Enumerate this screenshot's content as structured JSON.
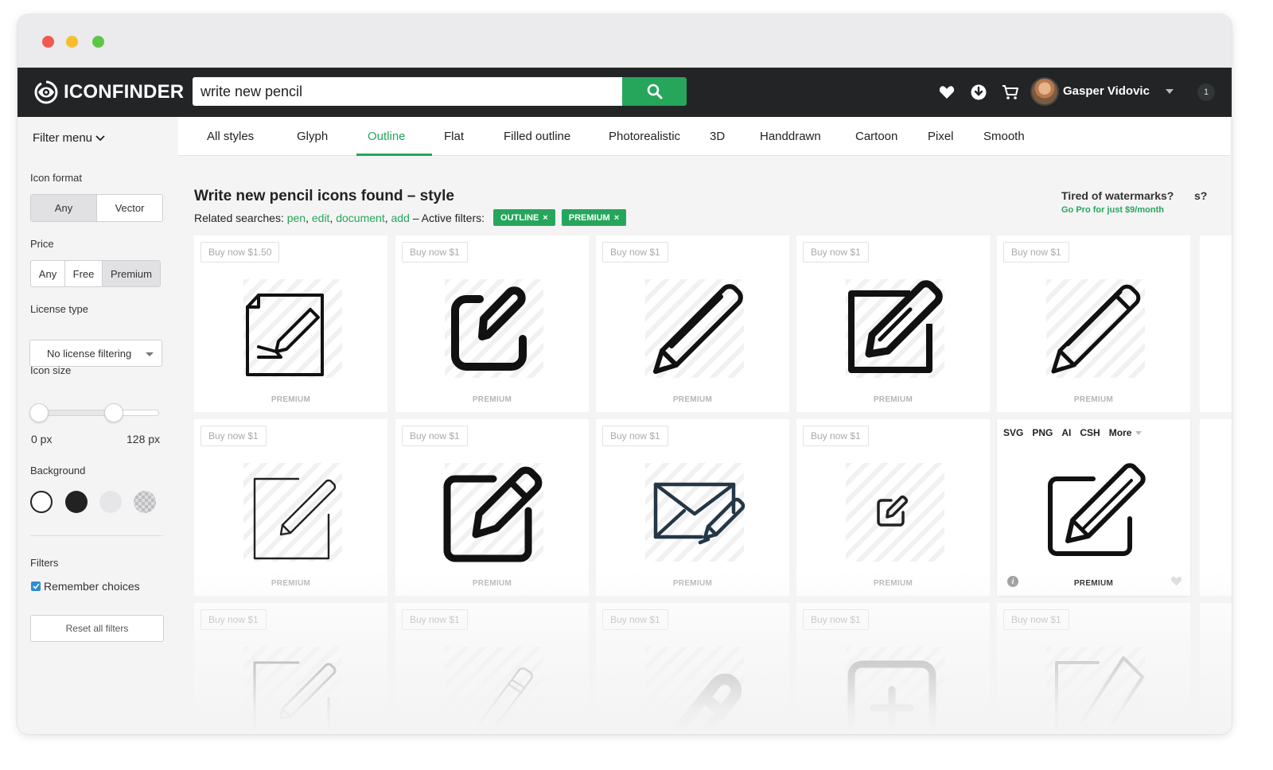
{
  "header": {
    "logo_text": "ICONFINDER",
    "search_value": "write new pencil",
    "user_name": "Gasper Vidovic",
    "notification_count": "1"
  },
  "sidebar": {
    "filter_menu_label": "Filter menu",
    "icon_format": {
      "label": "Icon format",
      "options": [
        "Any",
        "Vector"
      ],
      "selected": "Any"
    },
    "price": {
      "label": "Price",
      "options": [
        "Any",
        "Free",
        "Premium"
      ],
      "selected": "Premium"
    },
    "license_type": {
      "label": "License type",
      "selected": "No license filtering"
    },
    "icon_size": {
      "label": "Icon size",
      "min_label": "0 px",
      "max_label": "128 px"
    },
    "background": {
      "label": "Background",
      "swatches": [
        "white",
        "black",
        "light-grey",
        "transparent"
      ]
    },
    "filters_label": "Filters",
    "remember_choices": "Remember choices",
    "reset_label": "Reset all filters"
  },
  "style_tabs": {
    "items": [
      "All styles",
      "Glyph",
      "Outline",
      "Flat",
      "Filled outline",
      "Photorealistic",
      "3D",
      "Handdrawn",
      "Cartoon",
      "Pixel",
      "Smooth"
    ],
    "active": "Outline"
  },
  "results": {
    "title": "Write new pencil icons found – style",
    "related_prefix": "Related searches:",
    "related_links": [
      "pen",
      "edit",
      "document",
      "add"
    ],
    "active_filters_label": "– Active filters:",
    "active_filters": [
      "OUTLINE",
      "PREMIUM"
    ]
  },
  "promo": {
    "title": "Tired of watermarks?",
    "cut_text": "s?",
    "link": "Go Pro for just $9/month"
  },
  "hover_card": {
    "formats": [
      "SVG",
      "PNG",
      "AI",
      "CSH",
      "More"
    ],
    "premium_label": "PREMIUM",
    "info_label": "i"
  },
  "icon_cards": [
    {
      "price": "Buy now $1.50",
      "badge": "PREMIUM",
      "icon": "note-pencil-icon"
    },
    {
      "price": "Buy now $1",
      "badge": "PREMIUM",
      "icon": "rounded-edit-icon"
    },
    {
      "price": "Buy now $1",
      "badge": "PREMIUM",
      "icon": "pencil-icon"
    },
    {
      "price": "Buy now $1",
      "badge": "PREMIUM",
      "icon": "square-pencil-icon"
    },
    {
      "price": "Buy now $1",
      "badge": "PREMIUM",
      "icon": "pencil-outline-icon"
    },
    {
      "price": "Buy now $1",
      "badge": "PREMIUM",
      "icon": "thin-edit-icon"
    },
    {
      "price": "Buy now $1",
      "badge": "PREMIUM",
      "icon": "bold-edit-icon"
    },
    {
      "price": "Buy now $1",
      "badge": "PREMIUM",
      "icon": "mail-pencil-icon"
    },
    {
      "price": "Buy now $1",
      "badge": "PREMIUM",
      "icon": "small-edit-icon"
    },
    {
      "price": "",
      "badge": "PREMIUM",
      "icon": "edit-square-icon"
    },
    {
      "price": "Buy now $1",
      "badge": "",
      "icon": "thin-edit-icon"
    },
    {
      "price": "Buy now $1",
      "badge": "",
      "icon": "striped-pencil-icon"
    },
    {
      "price": "Buy now $1",
      "badge": "",
      "icon": "eraser-pencil-icon"
    },
    {
      "price": "Buy now $1",
      "badge": "",
      "icon": "plus-square-icon"
    },
    {
      "price": "Buy now $1",
      "badge": "",
      "icon": "diamond-edit-icon"
    }
  ],
  "colors": {
    "accent_green": "#26a65b",
    "topbar": "#222425",
    "checkbox_blue": "#2d8cd6"
  }
}
